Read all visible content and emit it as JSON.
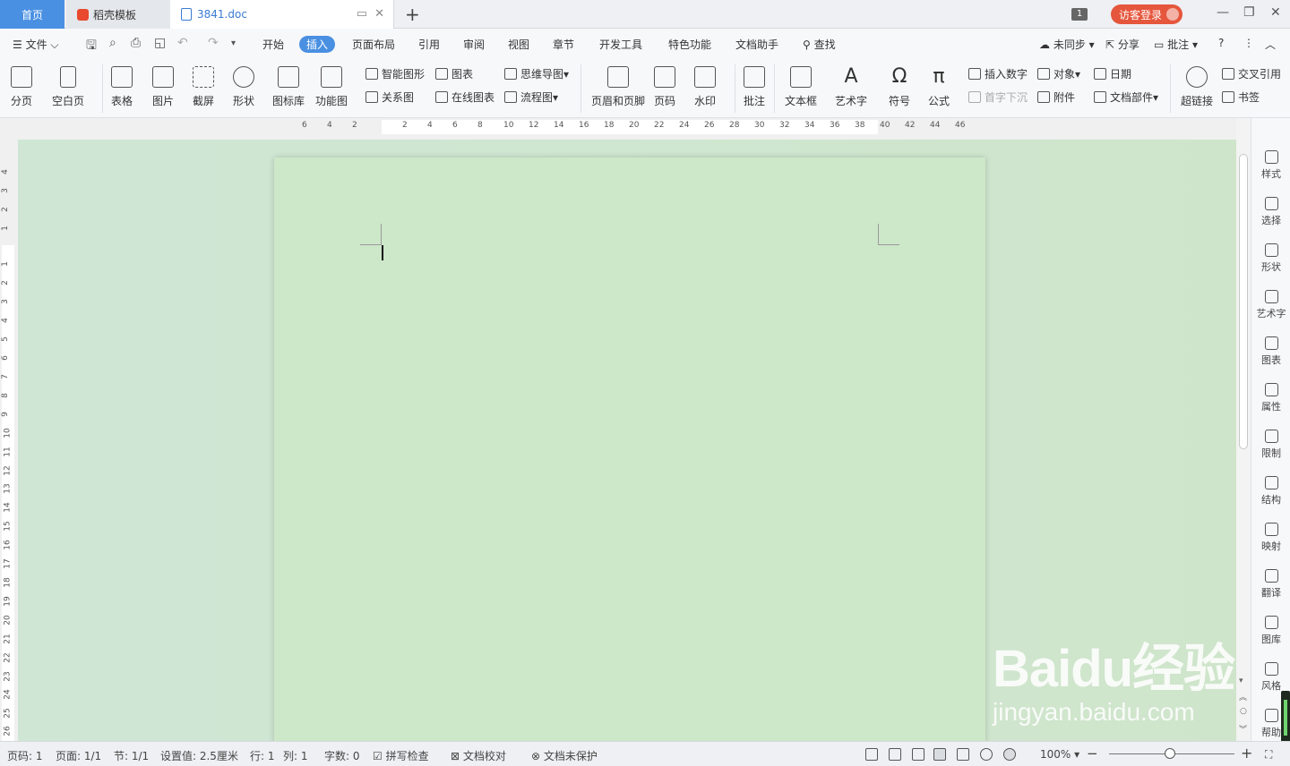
{
  "titlebar": {
    "tabs": {
      "home": "首页",
      "template": "稻壳模板",
      "document": "3841.doc"
    },
    "count_badge": "1",
    "login": "访客登录"
  },
  "menubar": {
    "file": "文件",
    "items": [
      "开始",
      "插入",
      "页面布局",
      "引用",
      "审阅",
      "视图",
      "章节",
      "开发工具",
      "特色功能",
      "文档助手"
    ],
    "active": "插入",
    "search": "查找",
    "sync": "未同步",
    "share": "分享",
    "comment": "批注"
  },
  "ribbon": {
    "large": {
      "page_break": "分页",
      "blank_page": "空白页",
      "table": "表格",
      "picture": "图片",
      "screenshot": "截屏",
      "shape": "形状",
      "icon_lib": "图标库",
      "function_chart": "功能图",
      "header_footer": "页眉和页脚",
      "page_number": "页码",
      "watermark": "水印",
      "comment": "批注",
      "textbox": "文本框",
      "wordart": "艺术字",
      "symbol": "符号",
      "formula": "公式",
      "hyperlink": "超链接"
    },
    "small": {
      "smart_shape": "智能图形",
      "relation": "关系图",
      "chart": "图表",
      "online_chart": "在线图表",
      "mindmap": "思维导图",
      "flowchart": "流程图",
      "insert_number": "插入数字",
      "dropcap": "首字下沉",
      "object": "对象",
      "attachment": "附件",
      "date": "日期",
      "doc_parts": "文档部件",
      "cross_ref": "交叉引用",
      "bookmark": "书签"
    }
  },
  "rulers": {
    "horizontal": [
      "6",
      "4",
      "2",
      "2",
      "4",
      "6",
      "8",
      "10",
      "12",
      "14",
      "16",
      "18",
      "20",
      "22",
      "24",
      "26",
      "28",
      "30",
      "32",
      "34",
      "36",
      "38",
      "40",
      "42",
      "44",
      "46"
    ],
    "vertical": [
      "4",
      "3",
      "2",
      "1",
      "1",
      "2",
      "3",
      "4",
      "5",
      "6",
      "7",
      "8",
      "9",
      "10",
      "11",
      "12",
      "13",
      "14",
      "15",
      "16",
      "17",
      "18",
      "19",
      "20",
      "21",
      "22",
      "23",
      "24",
      "25",
      "26"
    ]
  },
  "right_panel": [
    "样式",
    "选择",
    "形状",
    "艺术字",
    "图表",
    "属性",
    "限制",
    "结构",
    "映射",
    "翻译",
    "图库",
    "风格",
    "帮助"
  ],
  "statusbar": {
    "page_num": "页码: 1",
    "pages": "页面: 1/1",
    "section": "节: 1/1",
    "setting": "设置值: 2.5厘米",
    "row": "行: 1",
    "col": "列: 1",
    "words": "字数: 0",
    "spell": "拼写检查",
    "proof": "文档校对",
    "protect": "文档未保护",
    "zoom": "100%"
  },
  "watermark": {
    "brand": "Baidu经验",
    "url": "jingyan.baidu.com"
  },
  "colors": {
    "accent": "#4a90e2",
    "login": "#e5563c",
    "page": "#cde7c9"
  }
}
